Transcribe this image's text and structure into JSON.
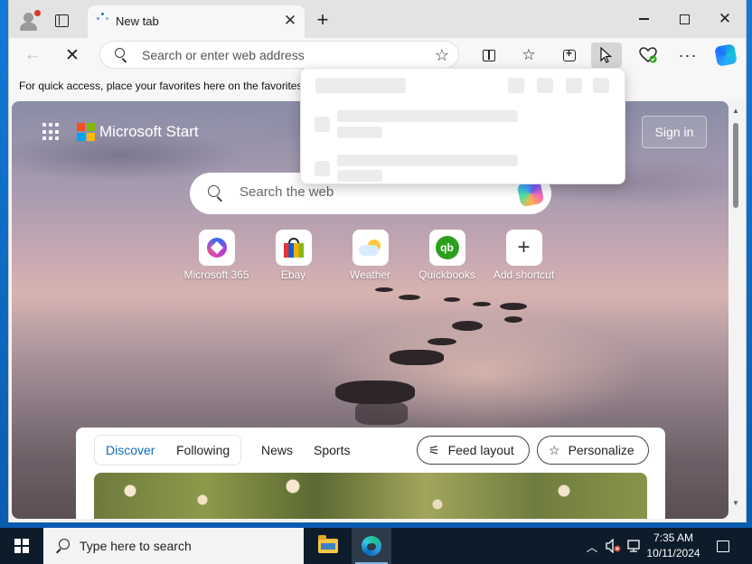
{
  "tab": {
    "title": "New tab",
    "close": "✕",
    "new_tab": "+"
  },
  "window": {
    "close": "✕"
  },
  "toolbar": {
    "back": "←",
    "stop": "✕",
    "address_placeholder": "Search or enter web address",
    "star": "☆",
    "favorites": "☆",
    "more": "···"
  },
  "favorites_bar": {
    "text": "For quick access, place your favorites here on the favorites bar."
  },
  "newtab": {
    "brand": "Microsoft Start",
    "sign_in": "Sign in",
    "search_placeholder": "Search the web",
    "shortcuts": [
      {
        "label": "Microsoft 365",
        "icon": "microsoft-365-icon"
      },
      {
        "label": "Ebay",
        "icon": "ebay-bag-icon"
      },
      {
        "label": "Weather",
        "icon": "weather-icon"
      },
      {
        "label": "Quickbooks",
        "icon": "quickbooks-icon",
        "glyph": "qb"
      },
      {
        "label": "Add shortcut",
        "icon": "plus-icon",
        "glyph": "+"
      }
    ],
    "feed": {
      "tabs": [
        "Discover",
        "Following",
        "News",
        "Sports"
      ],
      "active_tab": "Discover",
      "feed_layout": "Feed layout",
      "personalize": "Personalize"
    }
  },
  "taskbar": {
    "search_placeholder": "Type here to search",
    "time": "7:35 AM",
    "date": "10/11/2024",
    "chevron": "︿"
  },
  "colors": {
    "accent": "#0f6cbd",
    "taskbar": "#0d1c2b",
    "desktop": "#0a5cb0"
  }
}
